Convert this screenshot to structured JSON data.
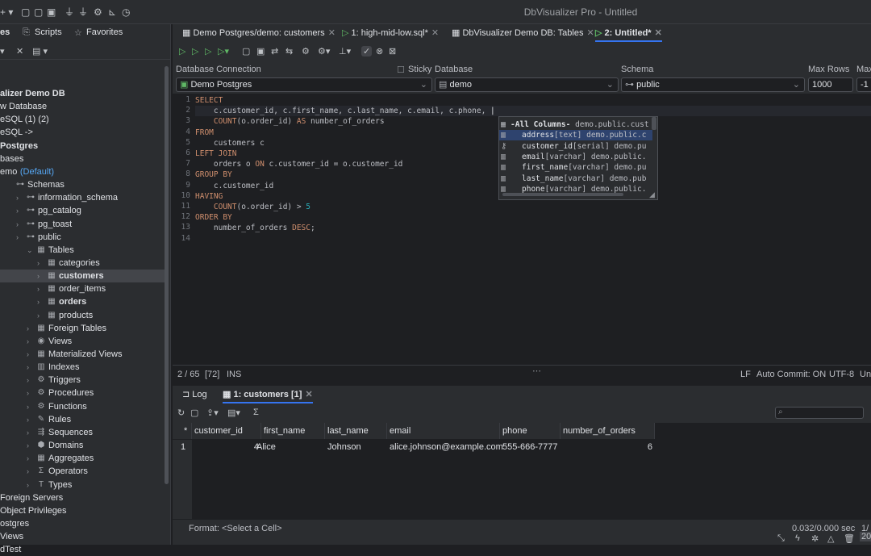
{
  "window": {
    "title": "DbVisualizer Pro - Untitled"
  },
  "left_panel": {
    "tabs": [
      {
        "label": "es"
      },
      {
        "label": "Scripts"
      },
      {
        "label": "Favorites"
      }
    ],
    "tree": [
      {
        "label": "alizer Demo DB",
        "bold": true
      },
      {
        "label": "w Database"
      },
      {
        "label": "eSQL (1) (2)"
      },
      {
        "label": "eSQL ->"
      },
      {
        "label": "Postgres",
        "bold": true
      },
      {
        "label": "bases"
      },
      {
        "label": "emo",
        "suffix": "(Default)"
      },
      {
        "label": "Schemas",
        "icon": "schemas-icon"
      },
      {
        "label": "information_schema",
        "icon": "schema-icon"
      },
      {
        "label": "pg_catalog",
        "icon": "schema-icon"
      },
      {
        "label": "pg_toast",
        "icon": "schema-icon"
      },
      {
        "label": "public",
        "icon": "schema-icon"
      },
      {
        "label": "Tables",
        "icon": "table-icon"
      },
      {
        "label": "categories",
        "icon": "table-icon"
      },
      {
        "label": "customers",
        "icon": "table-icon",
        "bold": true,
        "selected": true
      },
      {
        "label": "order_items",
        "icon": "table-icon"
      },
      {
        "label": "orders",
        "icon": "table-icon",
        "bold": true
      },
      {
        "label": "products",
        "icon": "table-icon"
      },
      {
        "label": "Foreign Tables",
        "icon": "table-icon"
      },
      {
        "label": "Views",
        "icon": "eye-icon"
      },
      {
        "label": "Materialized Views",
        "icon": "table-icon"
      },
      {
        "label": "Indexes",
        "icon": "index-icon"
      },
      {
        "label": "Triggers",
        "icon": "trigger-icon"
      },
      {
        "label": "Procedures",
        "icon": "gear-icon"
      },
      {
        "label": "Functions",
        "icon": "gear-icon"
      },
      {
        "label": "Rules",
        "icon": "wrench-icon"
      },
      {
        "label": "Sequences",
        "icon": "sequence-icon"
      },
      {
        "label": "Domains",
        "icon": "domain-icon"
      },
      {
        "label": "Aggregates",
        "icon": "table-icon"
      },
      {
        "label": "Operators",
        "icon": "sigma-icon"
      },
      {
        "label": "Types",
        "icon": "type-icon"
      },
      {
        "label": "Foreign Servers"
      },
      {
        "label": "Object Privileges"
      },
      {
        "label": "ostgres"
      },
      {
        "label": "Views"
      },
      {
        "label": "dTest"
      }
    ]
  },
  "editor_tabs": [
    {
      "label": "Demo Postgres/demo: customers"
    },
    {
      "label": "1: high-mid-low.sql*"
    },
    {
      "label": "DbVisualizer Demo DB: Tables"
    },
    {
      "label": "2: Untitled*",
      "active": true
    }
  ],
  "connection_bar": {
    "database_connection_label": "Database Connection",
    "database_connection_value": "Demo Postgres",
    "sticky_label": "Sticky",
    "database_label": "Database",
    "database_value": "demo",
    "schema_label": "Schema",
    "schema_value": "public",
    "max_rows_label": "Max Rows",
    "max_rows_value": "1000",
    "max_chars_label": "Max",
    "max_chars_value": "-1"
  },
  "editor": {
    "line_numbers": [
      "1",
      "2",
      "3",
      "4",
      "5",
      "6",
      "7",
      "8",
      "9",
      "10",
      "11",
      "12",
      "13",
      "14"
    ],
    "lines": [
      "SELECT",
      "    c.customer_id, c.first_name, c.last_name, c.email, c.phone, ",
      "    COUNT(o.order_id) AS number_of_orders",
      "FROM",
      "    customers c",
      "LEFT JOIN",
      "    orders o ON c.customer_id = o.customer_id",
      "GROUP BY",
      "    c.customer_id",
      "HAVING",
      "    COUNT(o.order_id) > 5",
      "ORDER BY",
      "    number_of_orders DESC;",
      ""
    ]
  },
  "autocomplete": [
    {
      "name": "-All Columns-",
      "type": "",
      "source": "demo.public.cust",
      "icon": "table-icon"
    },
    {
      "name": "address",
      "type": "[text]",
      "source": "demo.public.c",
      "icon": "column-icon",
      "selected": true
    },
    {
      "name": "customer_id",
      "type": "[serial]",
      "source": "demo.pu",
      "icon": "key-icon"
    },
    {
      "name": "email",
      "type": "[varchar]",
      "source": "demo.public.",
      "icon": "column-icon"
    },
    {
      "name": "first_name",
      "type": "[varchar]",
      "source": "demo.pu",
      "icon": "column-icon"
    },
    {
      "name": "last_name",
      "type": "[varchar]",
      "source": "demo.pub",
      "icon": "column-icon"
    },
    {
      "name": "phone",
      "type": "[varchar]",
      "source": "demo.public.",
      "icon": "column-icon"
    }
  ],
  "status_bar": {
    "position": "2 / 65",
    "offset": "[72]",
    "mode": "INS",
    "line_ending": "LF",
    "auto_commit": "Auto Commit: ON",
    "encoding": "UTF-8",
    "truncated": "Unt"
  },
  "results": {
    "tabs": [
      {
        "label": "Log"
      },
      {
        "label": "1: customers [1]",
        "active": true
      }
    ],
    "columns": [
      "customer_id",
      "first_name",
      "last_name",
      "email",
      "phone",
      "number_of_orders"
    ],
    "rows": [
      {
        "row": "1",
        "customer_id": "4",
        "first_name": "Alice",
        "last_name": "Johnson",
        "email": "alice.johnson@example.com",
        "phone": "555-666-7777",
        "number_of_orders": "6"
      }
    ],
    "header_marker": "*",
    "format_label": "Format: <Select a Cell>",
    "timing": "0.032/0.000 sec",
    "page": "1/",
    "corner": "20"
  }
}
